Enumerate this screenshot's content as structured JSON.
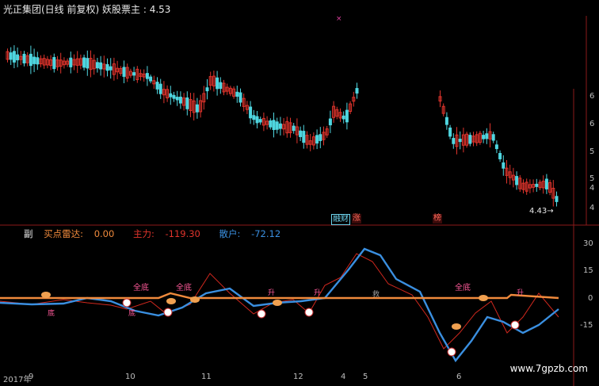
{
  "header": {
    "title": "光正集团(日线 前复权)",
    "indicator_label": "妖股票主 :",
    "indicator_value": "4.53"
  },
  "price_axis": {
    "ticks": [
      "6",
      "6",
      "5",
      "5",
      "4",
      "4"
    ]
  },
  "price_marker": {
    "label": "4.43"
  },
  "event_tags": {
    "tag1": "融",
    "tag2": "财",
    "tag3": "涨",
    "tag4": "榜"
  },
  "sub_panel": {
    "name": "副",
    "buy_radar_label": "买点雷达:",
    "buy_radar_value": "0.00",
    "main_force_label": "主力:",
    "main_force_value": "-119.30",
    "retail_label": "散户:",
    "retail_value": "-72.12",
    "axis_ticks": [
      "30",
      "15",
      "0",
      "-15"
    ],
    "signal_labels": {
      "quandi": "全底",
      "di": "底",
      "sheng": "升",
      "jiu": "救"
    }
  },
  "date_axis": {
    "labels": [
      "2017年",
      "9",
      "10",
      "11",
      "12",
      "4",
      "5",
      "6"
    ]
  },
  "watermark": "www.7gpzb.com",
  "colors": {
    "up": "#e0342c",
    "down": "#4fd6e0",
    "main_force": "#d0281e",
    "retail": "#3a8fe0",
    "radar": "#f08a3c",
    "grid": "#8b1a1a"
  }
}
